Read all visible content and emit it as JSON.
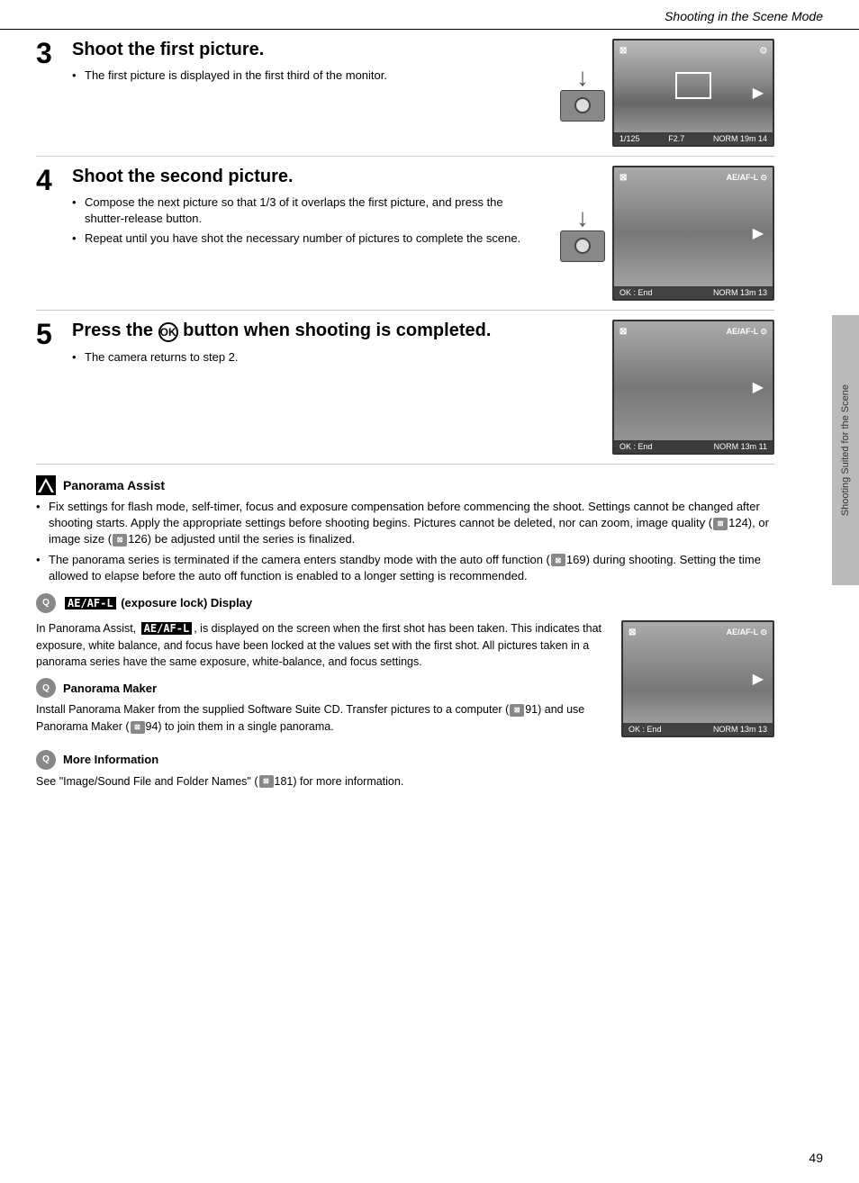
{
  "header": {
    "title": "Shooting in the Scene Mode"
  },
  "sidebar_tab": {
    "label": "Shooting Suited for the Scene"
  },
  "steps": [
    {
      "number": "3",
      "title": "Shoot the first picture.",
      "bullets": [
        "The first picture is displayed in the first third of the monitor."
      ],
      "screen": {
        "top_left": "H",
        "top_right": "⊙",
        "has_focus_bracket": true,
        "has_arrow": true,
        "bottom_left": "1/125",
        "bottom_middle": "F2.7",
        "bottom_right_label": "NORM",
        "bottom_right_size": "19m",
        "bottom_counter": "14"
      }
    },
    {
      "number": "4",
      "title": "Shoot the second picture.",
      "bullets": [
        "Compose the next picture so that 1/3 of it overlaps the first picture, and press the shutter-release button.",
        "Repeat until you have shot the necessary number of pictures to complete the scene."
      ],
      "screen": {
        "top_left": "H",
        "top_right_ae": "AE/AF-L ⊙",
        "has_arrow": true,
        "bottom_ok": "OK : End",
        "bottom_right_label": "NORM",
        "bottom_right_size": "13m",
        "bottom_counter": "13"
      }
    },
    {
      "number": "5",
      "title": "Press the OK button when shooting is completed.",
      "bullets": [
        "The camera returns to step 2."
      ],
      "screen": {
        "top_left": "H",
        "top_right_ae": "AE/AF-L ⊙",
        "has_arrow": true,
        "bottom_ok": "OK : End",
        "bottom_right_label": "NORM",
        "bottom_right_size": "13m",
        "bottom_counter": "11"
      }
    }
  ],
  "panorama_assist": {
    "icon": "M",
    "title": "Panorama Assist",
    "bullets": [
      "Fix settings for flash mode, self-timer, focus and exposure compensation before commencing the shoot. Settings cannot be changed after shooting starts. Apply the appropriate settings before shooting begins. Pictures cannot be deleted, nor can zoom, image quality (124), or image size (126) be adjusted until the series is finalized.",
      "The panorama series is terminated if the camera enters standby mode with the auto off function (169) during shooting. Setting the time allowed to elapse before the auto off function is enabled to a longer setting is recommended."
    ]
  },
  "ae_af_section": {
    "icon": "Q",
    "title_ae": "AE/AF-L",
    "title_rest": "(exposure lock) Display",
    "body": "In Panorama Assist, AE/AF-L is displayed on the screen when the first shot has been taken. This indicates that exposure, white balance, and focus have been locked at the values set with the first shot. All pictures taken in a panorama series have the same exposure, white-balance, and focus settings.",
    "screen": {
      "top_left": "H",
      "top_right_ae": "AE/AF-L ⊙",
      "has_arrow": true,
      "bottom_ok": "OK : End",
      "bottom_right_label": "NORM",
      "bottom_right_size": "13m",
      "bottom_counter": "13"
    }
  },
  "panorama_maker": {
    "icon": "Q",
    "title": "Panorama Maker",
    "body": "Install Panorama Maker from the supplied Software Suite CD. Transfer pictures to a computer (91) and use Panorama Maker (94) to join them in a single panorama."
  },
  "more_info": {
    "icon": "Q",
    "title": "More Information",
    "body": "See \"Image/Sound File and Folder Names\" (181) for more information."
  },
  "page_number": "49"
}
